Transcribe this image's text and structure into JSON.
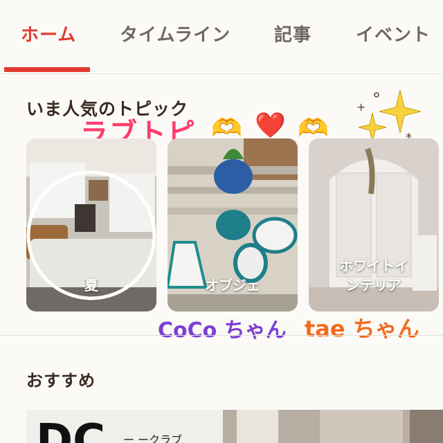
{
  "tabs": [
    {
      "label": "ホーム",
      "active": true
    },
    {
      "label": "タイムライン",
      "active": false
    },
    {
      "label": "記事",
      "active": false
    },
    {
      "label": "イベント",
      "active": false
    }
  ],
  "popular": {
    "title": "いま人気のトピック",
    "overlay": "ラブトピ",
    "cards": [
      {
        "label": "夏"
      },
      {
        "label": "オブジェ"
      },
      {
        "label": "ホワイトイ\nンテリア"
      }
    ],
    "credits": [
      "CoCo ちゃん",
      "tae ちゃん"
    ]
  },
  "recommend": {
    "title": "おすすめ",
    "preview_big": "DC",
    "preview_small": "ー ークラブ"
  },
  "colors": {
    "accent": "#e23a2f",
    "overlay_pink": "#ff3b6b",
    "credit_purple": "#7b3fd6",
    "credit_orange": "#f36b1e"
  },
  "icons": [
    "heart-hands-icon",
    "red-heart-icon",
    "sparkles-icon"
  ]
}
